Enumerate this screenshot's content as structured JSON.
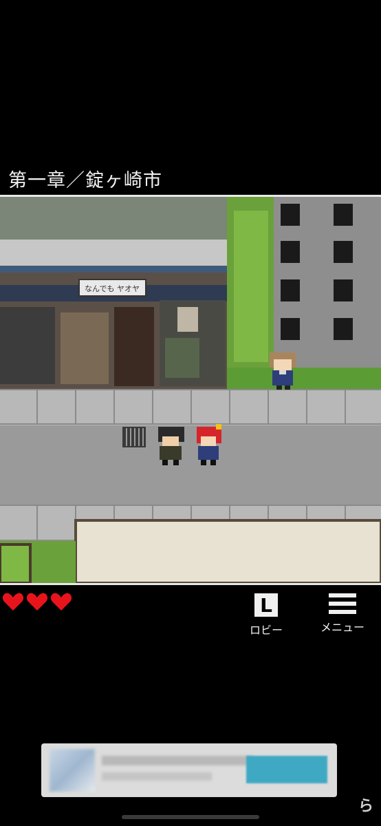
{
  "header": {
    "chapter_title": "第一章／錠ヶ崎市"
  },
  "scene": {
    "shop_sign": "なんでも ヤオヤ",
    "characters": [
      "girl-brown-hair",
      "boy-dark-hair",
      "girl-red-hair"
    ]
  },
  "hud": {
    "hearts": 3,
    "heart_color": "#e8141b",
    "lobby": {
      "glyph": "L",
      "label": "ロビー"
    },
    "menu": {
      "label": "メニュー"
    }
  },
  "ad": {
    "cta_color": "#3fa9c4"
  }
}
